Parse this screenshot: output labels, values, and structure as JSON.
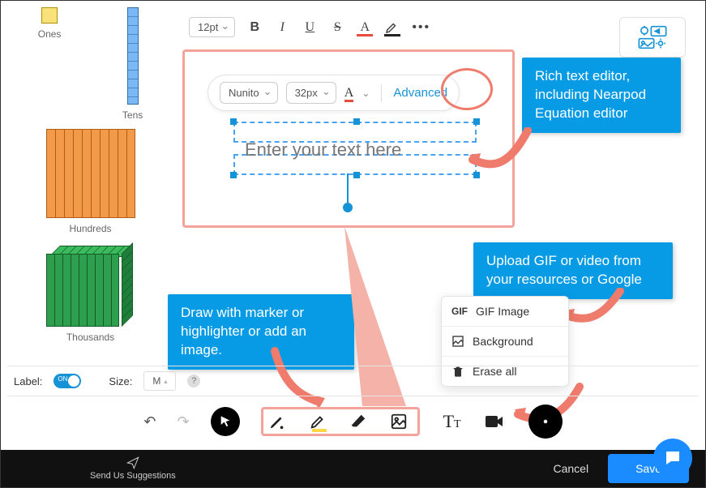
{
  "blocks": {
    "ones": "Ones",
    "tens": "Tens",
    "hundreds": "Hundreds",
    "thousands": "Thousands"
  },
  "top_toolbar": {
    "font_size": "12pt"
  },
  "text_toolbar": {
    "font_family": "Nunito",
    "font_size": "32px",
    "advanced": "Advanced"
  },
  "text_placeholder": "Enter your text here",
  "callouts": {
    "rich_text": "Rich text editor, including Nearpod Equation editor",
    "upload_gif": "Upload GIF or video from your resources or Google",
    "draw": "Draw with marker or highlighter or add an image."
  },
  "popup": {
    "gif_tag": "GIF",
    "gif_label": "GIF Image",
    "background": "Background",
    "erase": "Erase all"
  },
  "labelbar": {
    "label": "Label:",
    "toggle_on": "ON",
    "size_label": "Size:",
    "size_value": "M"
  },
  "footer": {
    "suggest": "Send Us Suggestions",
    "cancel": "Cancel",
    "save": "Save"
  }
}
